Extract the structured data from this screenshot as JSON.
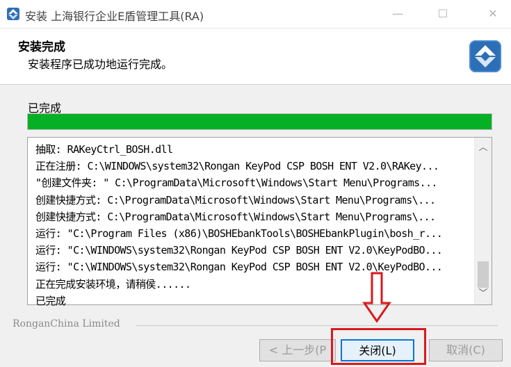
{
  "window": {
    "title": "安装 上海银行企业E盾管理工具(RA)",
    "minimize_glyph": "—",
    "maximize_glyph": "☐",
    "close_glyph": "✕",
    "icon": "installer-app-icon"
  },
  "header": {
    "title": "安装完成",
    "subtitle": "安装程序已成功地运行完成。",
    "logo_icon": "installer-logo-icon",
    "logo_color": "#2d6fb6"
  },
  "status_label": "已完成",
  "progress": {
    "percent": 100,
    "color": "#06b025"
  },
  "log": {
    "lines": [
      "抽取: RAKeyCtrl_BOSH.dll",
      "正在注册: C:\\WINDOWS\\system32\\Rongan KeyPod CSP BOSH ENT V2.0\\RAKey...",
      "\"创建文件夹: \" C:\\ProgramData\\Microsoft\\Windows\\Start Menu\\Programs...",
      "创建快捷方式: C:\\ProgramData\\Microsoft\\Windows\\Start Menu\\Programs\\...",
      "创建快捷方式: C:\\ProgramData\\Microsoft\\Windows\\Start Menu\\Programs\\...",
      "运行: \"C:\\Program Files (x86)\\BOSHEbankTools\\BOSHEbankPlugin\\bosh_r...",
      "运行: \"C:\\WINDOWS\\system32\\Rongan KeyPod CSP BOSH ENT V2.0\\KeyPodBO...",
      "运行: \"C:\\WINDOWS\\system32\\Rongan KeyPod CSP BOSH ENT V2.0\\KeyPodBO...",
      "正在完成安装环境，请稍侯......",
      "已完成"
    ],
    "scroll_up_glyph": "︿",
    "scroll_down_glyph": "﹀"
  },
  "footer": {
    "company": "RonganChina Limited",
    "back_label": "< 上一步(P",
    "close_label": "关闭(L)",
    "cancel_label": "取消(C)"
  },
  "annotation": {
    "color": "#d9191e"
  }
}
